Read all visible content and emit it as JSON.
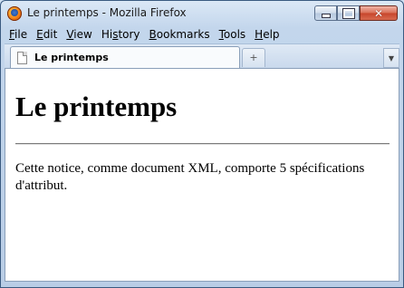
{
  "window": {
    "title": "Le printemps - Mozilla Firefox"
  },
  "menubar": {
    "items": [
      {
        "accel": "F",
        "rest": "ile"
      },
      {
        "accel": "E",
        "rest": "dit"
      },
      {
        "accel": "V",
        "rest": "iew"
      },
      {
        "pre": "Hi",
        "accel": "s",
        "rest": "tory"
      },
      {
        "accel": "B",
        "rest": "ookmarks"
      },
      {
        "accel": "T",
        "rest": "ools"
      },
      {
        "accel": "H",
        "rest": "elp"
      }
    ]
  },
  "tabs": {
    "active_label": "Le printemps",
    "newtab_glyph": "+"
  },
  "page": {
    "heading": "Le printemps",
    "paragraph": "Cette notice, comme document XML, comporte 5 spécifications d'attribut."
  }
}
